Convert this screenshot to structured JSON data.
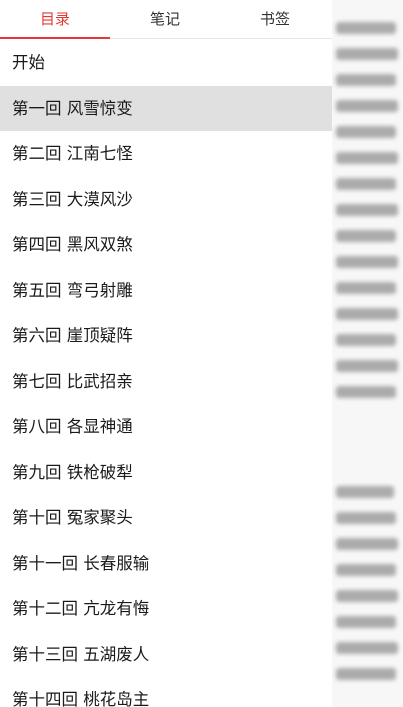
{
  "tabs": {
    "contents": "目录",
    "notes": "笔记",
    "bookmarks": "书签"
  },
  "toc": {
    "items": [
      {
        "label": "开始"
      },
      {
        "label": "第一回 风雪惊变"
      },
      {
        "label": "第二回 江南七怪"
      },
      {
        "label": "第三回 大漠风沙"
      },
      {
        "label": "第四回 黑风双煞"
      },
      {
        "label": "第五回 弯弓射雕"
      },
      {
        "label": "第六回 崖顶疑阵"
      },
      {
        "label": "第七回 比武招亲"
      },
      {
        "label": "第八回 各显神通"
      },
      {
        "label": "第九回 铁枪破犁"
      },
      {
        "label": "第十回 冤家聚头"
      },
      {
        "label": "第十一回 长春服输"
      },
      {
        "label": "第十二回 亢龙有悔"
      },
      {
        "label": "第十三回 五湖废人"
      },
      {
        "label": "第十四回 桃花岛主"
      }
    ],
    "selected_index": 1
  },
  "colors": {
    "accent": "#e53935",
    "selected_row": "#e0e0e0"
  }
}
